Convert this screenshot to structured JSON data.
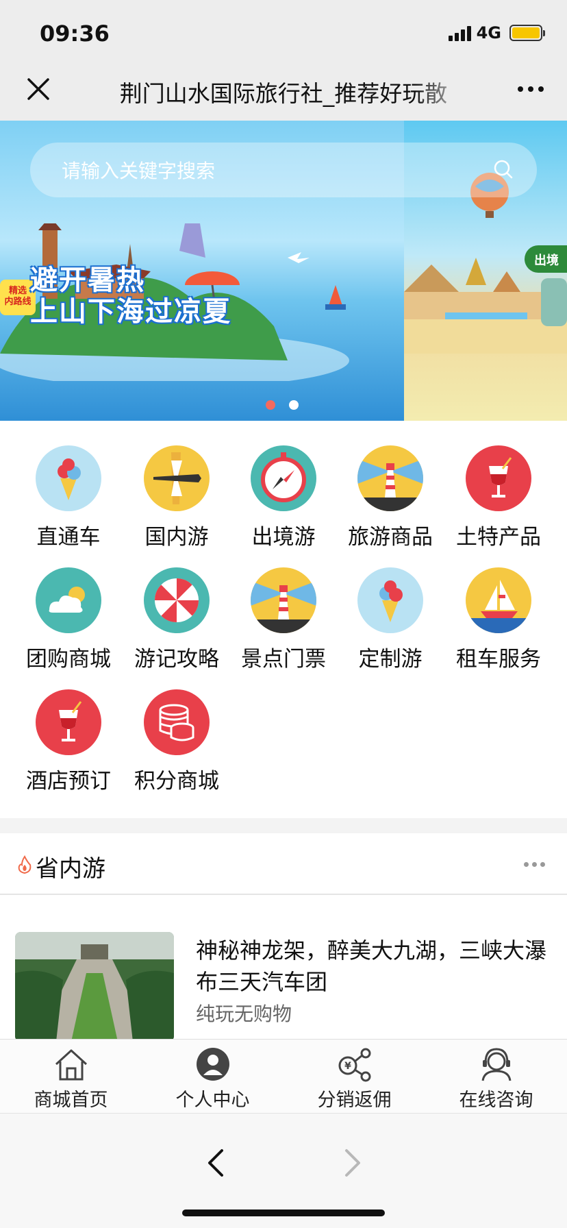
{
  "status_bar": {
    "time": "09:36",
    "network": "4G",
    "battery_fill": 1.0
  },
  "nav": {
    "title": "荆门山水国际旅行社_推荐好玩散",
    "close_icon": "close-icon",
    "more_icon": "more-dots-icon"
  },
  "banner": {
    "search_placeholder": "请输入关键字搜索",
    "headline_line1": "避开暑热",
    "headline_line2": "上山下海过凉夏",
    "tag": "精选\n内路线",
    "slide2_tag": "出境",
    "slides": 2,
    "active_slide": 1,
    "dot_active_color": "#f46a5e"
  },
  "categories": [
    {
      "label": "直通车",
      "icon": "ice-cream-icon"
    },
    {
      "label": "国内游",
      "icon": "airplane-icon"
    },
    {
      "label": "出境游",
      "icon": "compass-icon"
    },
    {
      "label": "旅游商品",
      "icon": "lighthouse-icon"
    },
    {
      "label": "土特产品",
      "icon": "cocktail-icon"
    },
    {
      "label": "团购商城",
      "icon": "weather-icon"
    },
    {
      "label": "游记攻略",
      "icon": "beach-umbrella-icon"
    },
    {
      "label": "景点门票",
      "icon": "lighthouse-icon"
    },
    {
      "label": "定制游",
      "icon": "ice-cream-icon"
    },
    {
      "label": "租车服务",
      "icon": "sailboat-icon"
    },
    {
      "label": "酒店预订",
      "icon": "cocktail-icon"
    },
    {
      "label": "积分商城",
      "icon": "coins-icon"
    }
  ],
  "section": {
    "title": "省内游",
    "icon": "flame-icon"
  },
  "product": {
    "title": "神秘神龙架，醉美大九湖，三峡大瀑布三天汽车团",
    "subtitle": "纯玩无购物"
  },
  "tabs": [
    {
      "label": "商城首页",
      "icon": "home-icon"
    },
    {
      "label": "个人中心",
      "icon": "user-icon"
    },
    {
      "label": "分销返佣",
      "icon": "share-commission-icon"
    },
    {
      "label": "在线咨询",
      "icon": "customer-service-icon"
    }
  ],
  "colors": {
    "accent_red": "#e8404a",
    "teal": "#4bb8b0",
    "yellow": "#f5c842",
    "sky": "#b9e2f3"
  }
}
